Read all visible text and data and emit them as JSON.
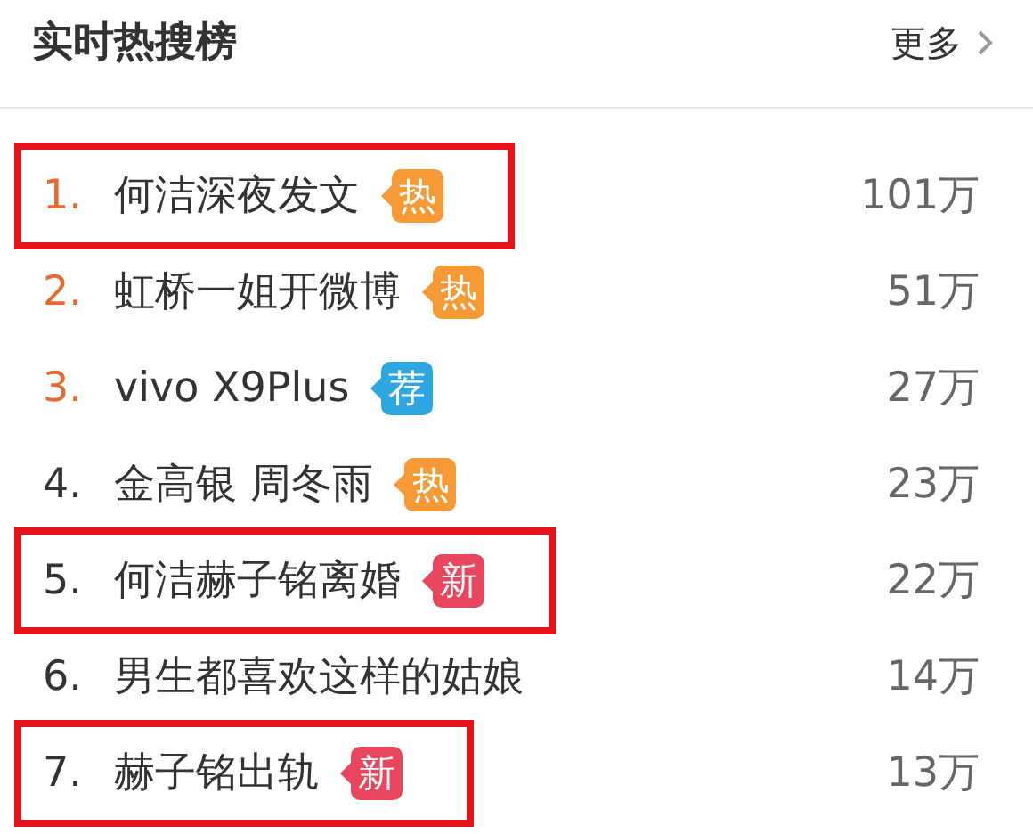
{
  "header": {
    "title": "实时热搜榜",
    "more": "更多"
  },
  "rows": [
    {
      "rank": "1.",
      "accent": true,
      "title": "何洁深夜发文",
      "badge": {
        "kind": "hot",
        "label": "热"
      },
      "count": "101万",
      "boxed": true
    },
    {
      "rank": "2.",
      "accent": true,
      "title": "虹桥一姐开微博",
      "badge": {
        "kind": "hot",
        "label": "热"
      },
      "count": "51万",
      "boxed": false
    },
    {
      "rank": "3.",
      "accent": true,
      "title": "vivo X9Plus",
      "badge": {
        "kind": "recommended",
        "label": "荐"
      },
      "count": "27万",
      "boxed": false
    },
    {
      "rank": "4.",
      "accent": false,
      "title": "金高银 周冬雨",
      "badge": {
        "kind": "hot",
        "label": "热"
      },
      "count": "23万",
      "boxed": false
    },
    {
      "rank": "5.",
      "accent": false,
      "title": "何洁赫子铭离婚",
      "badge": {
        "kind": "new",
        "label": "新"
      },
      "count": "22万",
      "boxed": true
    },
    {
      "rank": "6.",
      "accent": false,
      "title": "男生都喜欢这样的姑娘",
      "count": "14万",
      "boxed": false
    },
    {
      "rank": "7.",
      "accent": false,
      "title": "赫子铭出轨",
      "badge": {
        "kind": "new",
        "label": "新"
      },
      "count": "13万",
      "boxed": true
    }
  ]
}
